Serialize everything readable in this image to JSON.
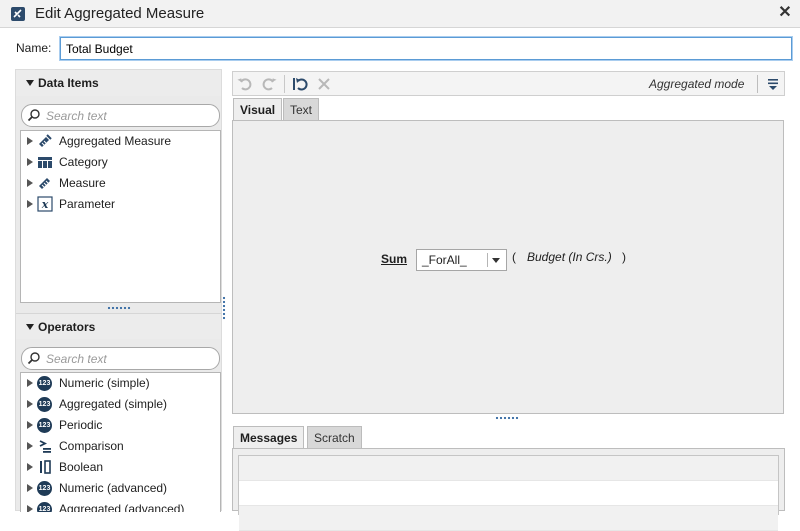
{
  "window": {
    "title": "Edit Aggregated Measure",
    "close_icon": "close-icon"
  },
  "name_field": {
    "label": "Name:",
    "value": "Total Budget"
  },
  "data_items": {
    "header": "Data Items",
    "search_placeholder": "Search text",
    "items": [
      {
        "label": "Aggregated Measure",
        "icon": "aggregated-measure-icon"
      },
      {
        "label": "Category",
        "icon": "category-icon"
      },
      {
        "label": "Measure",
        "icon": "measure-icon"
      },
      {
        "label": "Parameter",
        "icon": "parameter-icon"
      }
    ]
  },
  "operators": {
    "header": "Operators",
    "search_placeholder": "Search text",
    "items": [
      {
        "label": "Numeric (simple)",
        "icon": "123-icon"
      },
      {
        "label": "Aggregated (simple)",
        "icon": "123-icon"
      },
      {
        "label": "Periodic",
        "icon": "123-icon"
      },
      {
        "label": "Comparison",
        "icon": "comparison-icon"
      },
      {
        "label": "Boolean",
        "icon": "boolean-icon"
      },
      {
        "label": "Numeric (advanced)",
        "icon": "123-icon"
      },
      {
        "label": "Aggregated (advanced)",
        "icon": "123-icon"
      }
    ]
  },
  "toolbar": {
    "buttons": [
      "undo-icon",
      "redo-icon",
      "reset-icon",
      "delete-icon"
    ],
    "mode_label": "Aggregated mode",
    "menu_icon": "mode-menu-icon"
  },
  "editor_tabs": {
    "visual": "Visual",
    "text": "Text",
    "active": "Visual"
  },
  "expression": {
    "function": "Sum",
    "scope_value": "_ForAll_",
    "open_paren": "(",
    "argument": "Budget (In Crs.)",
    "close_paren": ")"
  },
  "bottom_tabs": {
    "messages": "Messages",
    "scratch": "Scratch",
    "active": "Messages"
  },
  "colors": {
    "accent_blue": "#5b9bd5",
    "badge_navy": "#1f3b57",
    "panel_gray": "#eeeeee"
  }
}
